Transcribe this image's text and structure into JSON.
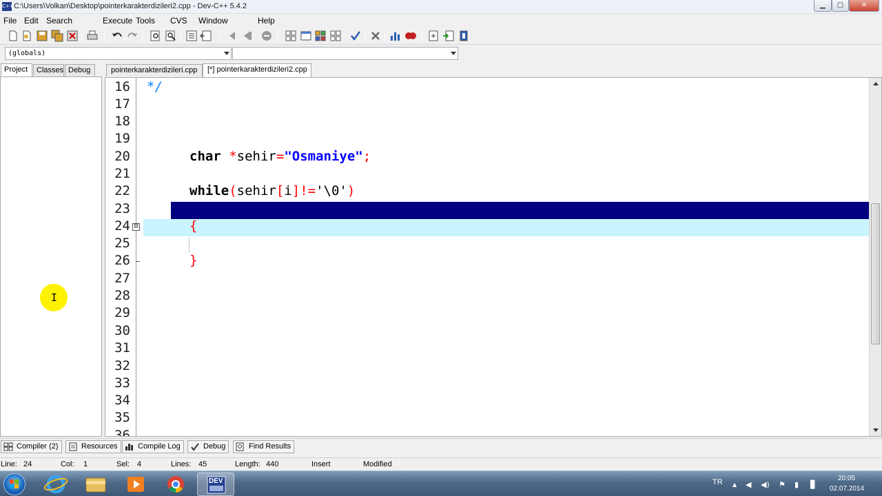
{
  "window": {
    "icon_label": "C++",
    "title": "C:\\Users\\Volkan\\Desktop\\pointerkarakterdizileri2.cpp - Dev-C++ 5.4.2",
    "minimize": "▁",
    "maximize": "▢",
    "close": "✕"
  },
  "menu": [
    "File",
    "Edit",
    "Search",
    "Execute",
    "Tools",
    "CVS",
    "Window",
    "Help"
  ],
  "toolbar_icons": [
    "new-file",
    "open",
    "save",
    "save-all",
    "close",
    "print",
    "undo",
    "redo",
    "find",
    "replace",
    "indent",
    "unindent",
    "back",
    "forward",
    "goto",
    "new-class",
    "new-member",
    "compile",
    "run",
    "compile-run",
    "check",
    "stop",
    "chart",
    "debug",
    "insert",
    "toggle",
    "bookmark"
  ],
  "combo": {
    "scope": "(globals)",
    "member": ""
  },
  "left_tabs": [
    "Project",
    "Classes",
    "Debug"
  ],
  "editor_tabs": [
    "pointerkarakterdizileri.cpp",
    "[*] pointerkarakterdizileri2.cpp"
  ],
  "cursor_glyph": "I",
  "fold_symbol": "⊟",
  "code_lines": [
    {
      "n": "16",
      "text": "*/"
    },
    {
      "n": "17",
      "text": ""
    },
    {
      "n": "18",
      "text": ""
    },
    {
      "n": "19",
      "text": ""
    },
    {
      "n": "20",
      "kw": "char",
      "t1": " *",
      "ident": "sehir",
      "op": "=",
      "str": "\"Osmaniye\"",
      "end": ";"
    },
    {
      "n": "21",
      "text": ""
    },
    {
      "n": "22",
      "kw": "while",
      "p1": "(",
      "ident": "sehir",
      "b1": "[",
      "i": "i",
      "b2": "]",
      "op": "!=",
      "chr": "'\\0'",
      "p2": ")"
    },
    {
      "n": "23",
      "text": ""
    },
    {
      "n": "24",
      "text": "{"
    },
    {
      "n": "25",
      "text": ""
    },
    {
      "n": "26",
      "text": "}"
    },
    {
      "n": "27",
      "text": ""
    },
    {
      "n": "28",
      "text": ""
    },
    {
      "n": "29",
      "text": ""
    },
    {
      "n": "30",
      "text": ""
    },
    {
      "n": "31",
      "text": ""
    },
    {
      "n": "32",
      "text": ""
    },
    {
      "n": "33",
      "text": ""
    },
    {
      "n": "34",
      "text": ""
    },
    {
      "n": "35",
      "text": ""
    },
    {
      "n": "36",
      "text": ""
    }
  ],
  "bottom_tabs": [
    "Compiler (2)",
    "Resources",
    "Compile Log",
    "Debug",
    "Find Results"
  ],
  "status": {
    "line_label": "Line:",
    "line_value": "24",
    "col_label": "Col:",
    "col_value": "1",
    "sel_label": "Sel:",
    "sel_value": "4",
    "lines_label": "Lines:",
    "lines_value": "45",
    "length_label": "Length:",
    "length_value": "440",
    "mode": "Insert",
    "state": "Modified"
  },
  "taskbar": {
    "dev_label": "DEV",
    "tray_lang": "TR",
    "tray_up": "▲",
    "tray_icons": [
      "◀",
      "◀)",
      "⚑",
      "▮",
      "▊"
    ],
    "time": "20:05",
    "date": "02.07.2014"
  },
  "colors": {
    "current_line_dark": "#000080",
    "current_line_light": "#c8f5ff",
    "keyword": "#000000",
    "string": "#0000ff",
    "symbol": "#ff0000",
    "comment": "#0080ff"
  }
}
